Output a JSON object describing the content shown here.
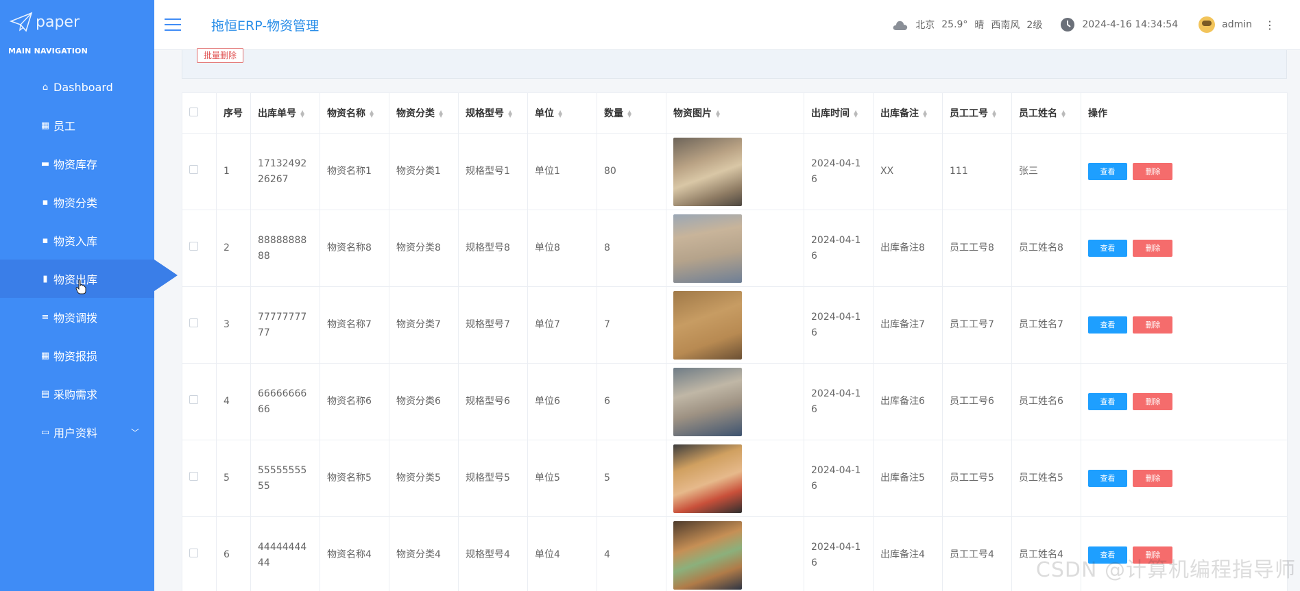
{
  "sidebar": {
    "logo_text": "paper",
    "section_title": "MAIN NAVIGATION",
    "items": [
      {
        "label": "Dashboard",
        "icon": "home-icon"
      },
      {
        "label": "员工",
        "icon": "grid-icon"
      },
      {
        "label": "物资库存",
        "icon": "keyboard-icon"
      },
      {
        "label": "物资分类",
        "icon": "comment-icon"
      },
      {
        "label": "物资入库",
        "icon": "comment-icon"
      },
      {
        "label": "物资出库",
        "icon": "bar-chart-icon",
        "active": true
      },
      {
        "label": "物资调拨",
        "icon": "list-icon"
      },
      {
        "label": "物资报损",
        "icon": "grid-icon"
      },
      {
        "label": "采购需求",
        "icon": "clipboard-icon"
      },
      {
        "label": "用户资料",
        "icon": "card-icon",
        "has_submenu": true
      }
    ]
  },
  "header": {
    "title": "拖恒ERP-物资管理",
    "weather": {
      "city": "北京",
      "temp": "25.9°",
      "condition": "晴",
      "wind": "西南风",
      "level": "2级"
    },
    "datetime": "2024-4-16 14:34:54",
    "username": "admin"
  },
  "toolbar": {
    "batch_delete_label": "批量删除"
  },
  "table": {
    "columns": [
      "序号",
      "出库单号",
      "物资名称",
      "物资分类",
      "规格型号",
      "单位",
      "数量",
      "物资图片",
      "出库时间",
      "出库备注",
      "员工工号",
      "员工姓名",
      "操作"
    ],
    "view_label": "查看",
    "delete_label": "删除",
    "rows": [
      {
        "index": "1",
        "order_no": "1713249226267",
        "name": "物资名称1",
        "category": "物资分类1",
        "spec": "规格型号1",
        "unit": "单位1",
        "qty": "80",
        "time": "2024-04-16",
        "remark": "XX",
        "emp_no": "111",
        "emp_name": "张三"
      },
      {
        "index": "2",
        "order_no": "8888888888",
        "name": "物资名称8",
        "category": "物资分类8",
        "spec": "规格型号8",
        "unit": "单位8",
        "qty": "8",
        "time": "2024-04-16",
        "remark": "出库备注8",
        "emp_no": "员工工号8",
        "emp_name": "员工姓名8"
      },
      {
        "index": "3",
        "order_no": "7777777777",
        "name": "物资名称7",
        "category": "物资分类7",
        "spec": "规格型号7",
        "unit": "单位7",
        "qty": "7",
        "time": "2024-04-16",
        "remark": "出库备注7",
        "emp_no": "员工工号7",
        "emp_name": "员工姓名7"
      },
      {
        "index": "4",
        "order_no": "6666666666",
        "name": "物资名称6",
        "category": "物资分类6",
        "spec": "规格型号6",
        "unit": "单位6",
        "qty": "6",
        "time": "2024-04-16",
        "remark": "出库备注6",
        "emp_no": "员工工号6",
        "emp_name": "员工姓名6"
      },
      {
        "index": "5",
        "order_no": "5555555555",
        "name": "物资名称5",
        "category": "物资分类5",
        "spec": "规格型号5",
        "unit": "单位5",
        "qty": "5",
        "time": "2024-04-16",
        "remark": "出库备注5",
        "emp_no": "员工工号5",
        "emp_name": "员工姓名5"
      },
      {
        "index": "6",
        "order_no": "4444444444",
        "name": "物资名称4",
        "category": "物资分类4",
        "spec": "规格型号4",
        "unit": "单位4",
        "qty": "4",
        "time": "2024-04-16",
        "remark": "出库备注4",
        "emp_no": "员工工号4",
        "emp_name": "员工姓名4"
      }
    ]
  },
  "watermark": "CSDN @计算机编程指导师",
  "colors": {
    "sidebar": "#3f8cf6",
    "sidebar_active": "#3a7ee8",
    "view_button": "#1e9fff",
    "delete_button": "#f56c6c",
    "title": "#2a8ee8"
  }
}
